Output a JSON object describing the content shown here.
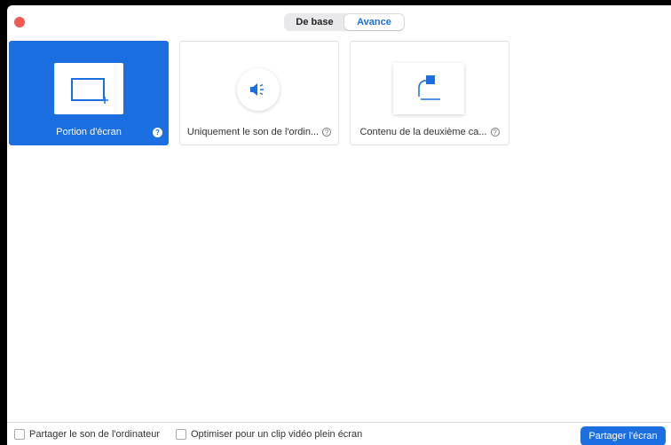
{
  "tabs": [
    {
      "label": "De base",
      "active": false
    },
    {
      "label": "Avance",
      "active": true
    }
  ],
  "cards": [
    {
      "label": "Portion d'écran",
      "icon": "screen-portion-icon",
      "selected": true
    },
    {
      "label": "Uniquement le son de l'ordin...",
      "icon": "speaker-icon",
      "selected": false
    },
    {
      "label": "Contenu de la deuxième ca...",
      "icon": "document-camera-icon",
      "selected": false
    }
  ],
  "help_glyph": "?",
  "footer": {
    "share_sound_label": "Partager le son de l'ordinateur",
    "optimize_video_label": "Optimiser pour un clip vidéo plein écran",
    "share_button_label": "Partager l'écran"
  },
  "colors": {
    "accent": "#1c6fe0",
    "close": "#ee5a55"
  }
}
